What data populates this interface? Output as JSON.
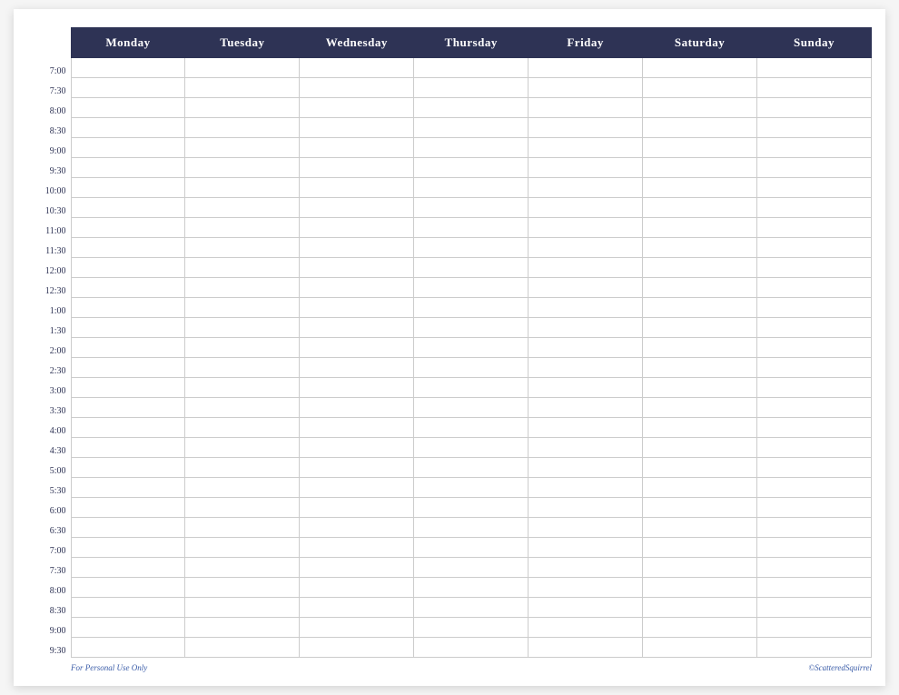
{
  "header": {
    "days": [
      "Monday",
      "Tuesday",
      "Wednesday",
      "Thursday",
      "Friday",
      "Saturday",
      "Sunday"
    ]
  },
  "timeSlots": [
    "7:00",
    "7:30",
    "8:00",
    "8:30",
    "9:00",
    "9:30",
    "10:00",
    "10:30",
    "11:00",
    "11:30",
    "12:00",
    "12:30",
    "1:00",
    "1:30",
    "2:00",
    "2:30",
    "3:00",
    "3:30",
    "4:00",
    "4:30",
    "5:00",
    "5:30",
    "6:00",
    "6:30",
    "7:00",
    "7:30",
    "8:00",
    "8:30",
    "9:00",
    "9:30"
  ],
  "footer": {
    "left": "For Personal Use Only",
    "right": "©ScatteredSquirrel"
  }
}
